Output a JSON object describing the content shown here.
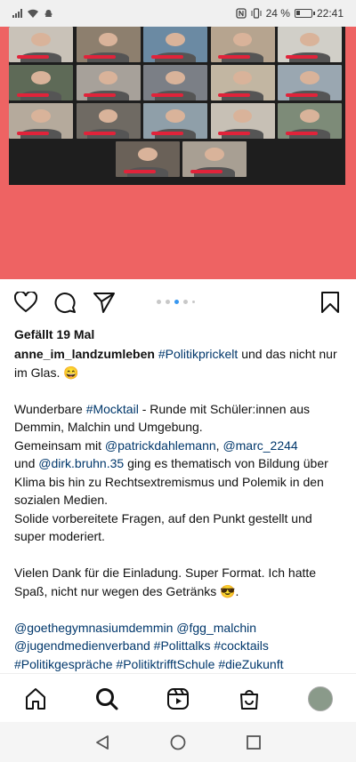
{
  "status_bar": {
    "battery": "24 %",
    "time": "22:41"
  },
  "post": {
    "likes_text": "Gefällt 19 Mal",
    "carousel": {
      "count": 5,
      "active": 2
    },
    "caption": {
      "username": "anne_im_landzumleben",
      "line1_tag": "#Politikprickelt",
      "line1_text": " und das nicht nur im Glas. 😄",
      "p2_a": "Wunderbare ",
      "p2_tag": "#Mocktail",
      "p2_b": " - Runde mit Schüler:innen aus Demmin,  Malchin und Umgebung.",
      "p2_c": "Gemeinsam mit ",
      "mention1": "@patrickdahlemann",
      "sep1": ", ",
      "mention2": "@marc_2244",
      "p2_d": " und ",
      "mention3": "@dirk.bruhn.35",
      "p2_e": " ging es thematisch von Bildung über Klima bis hin zu Rechtsextremismus und Polemik in den sozialen Medien.",
      "p2_f": "Solide vorbereitete Fragen, auf den Punkt gestellt und super moderiert.",
      "p3": "Vielen Dank für die Einladung. Super Format. Ich hatte Spaß,  nicht nur wegen des Getränks 😎.",
      "tags": [
        "@goethegymnasiumdemmin",
        "@fgg_malchin",
        "@jugendmedienverband",
        "#Polittalks",
        "#cocktails",
        "#Politikgespräche",
        "#PolitiktrifftSchule",
        "#dieZukunft"
      ]
    }
  },
  "bottom_nav": [
    "home-icon",
    "search-icon",
    "reels-icon",
    "shop-icon",
    "profile-avatar"
  ],
  "system_nav": [
    "back-icon",
    "home-circle-icon",
    "recents-icon"
  ],
  "colors": {
    "image_bg": "#ee6363",
    "link": "#00376b",
    "active_dot": "#3897f0"
  }
}
